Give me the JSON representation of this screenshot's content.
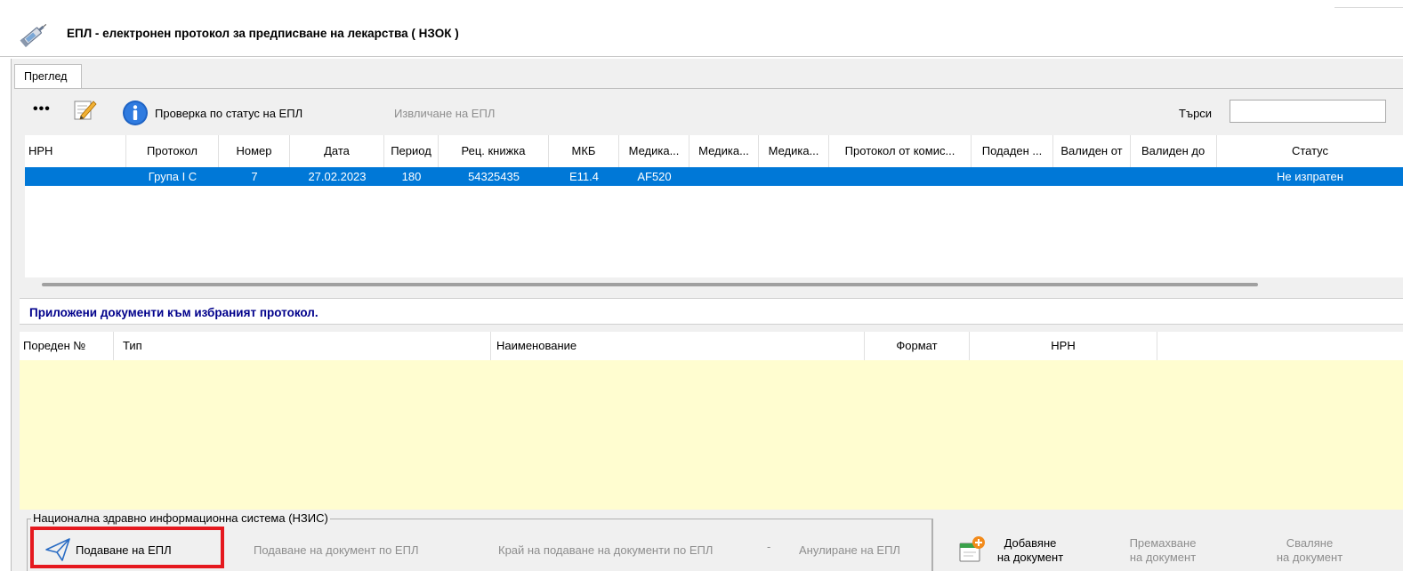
{
  "window": {
    "title": "ЕПЛ - електронен протокол за предписване на лекарства ( НЗОК )"
  },
  "tabs": [
    {
      "label": "Преглед"
    }
  ],
  "toolbar": {
    "more_label": "•••",
    "check_status_label": "Проверка по статус на ЕПЛ",
    "extract_label": "Извличане на ЕПЛ",
    "search_label": "Търси",
    "search_value": ""
  },
  "protocols_table": {
    "columns": [
      "НРН",
      "Протокол",
      "Номер",
      "Дата",
      "Период",
      "Рец. книжка",
      "МКБ",
      "Медика...",
      "Медика...",
      "Медика...",
      "Протокол от комис...",
      "Подаден ...",
      "Валиден от",
      "Валиден до",
      "Статус"
    ],
    "rows": [
      {
        "nrn": "",
        "protocol": "Група I С",
        "number": "7",
        "date": "27.02.2023",
        "period": "180",
        "book": "54325435",
        "mkb": "E11.4",
        "med1": "AF520",
        "med2": "",
        "med3": "",
        "commission": "",
        "submitted": "",
        "valid_from": "",
        "valid_to": "",
        "status": "Не изпратен"
      }
    ]
  },
  "attached_docs": {
    "heading": "Приложени документи към избраният протокол.",
    "columns": [
      "Пореден №",
      "Тип",
      "Наименование",
      "Формат",
      "НРН"
    ]
  },
  "nzis": {
    "legend": "Национална здравно информационна система (НЗИС)",
    "submit_label": "Подаване на  ЕПЛ",
    "submit_doc_label": "Подаване на документ по ЕПЛ",
    "end_submit_label": "Край на подаване на документи по ЕПЛ",
    "dash": "-",
    "cancel_label": "Анулиране на ЕПЛ"
  },
  "doc_actions": {
    "add_line1": "Добавяне",
    "add_line2": "на документ",
    "remove_line1": "Премахване",
    "remove_line2": "на документ",
    "download_line1": "Сваляне",
    "download_line2": "на документ"
  },
  "colors": {
    "selection": "#0078d7",
    "heading_blue": "#00008b",
    "highlight_red": "#e5191f",
    "grid_yellow": "#fffdd0"
  },
  "icons": [
    "syringe-icon",
    "edit-icon",
    "info-icon",
    "paper-plane-icon",
    "add-document-icon"
  ]
}
